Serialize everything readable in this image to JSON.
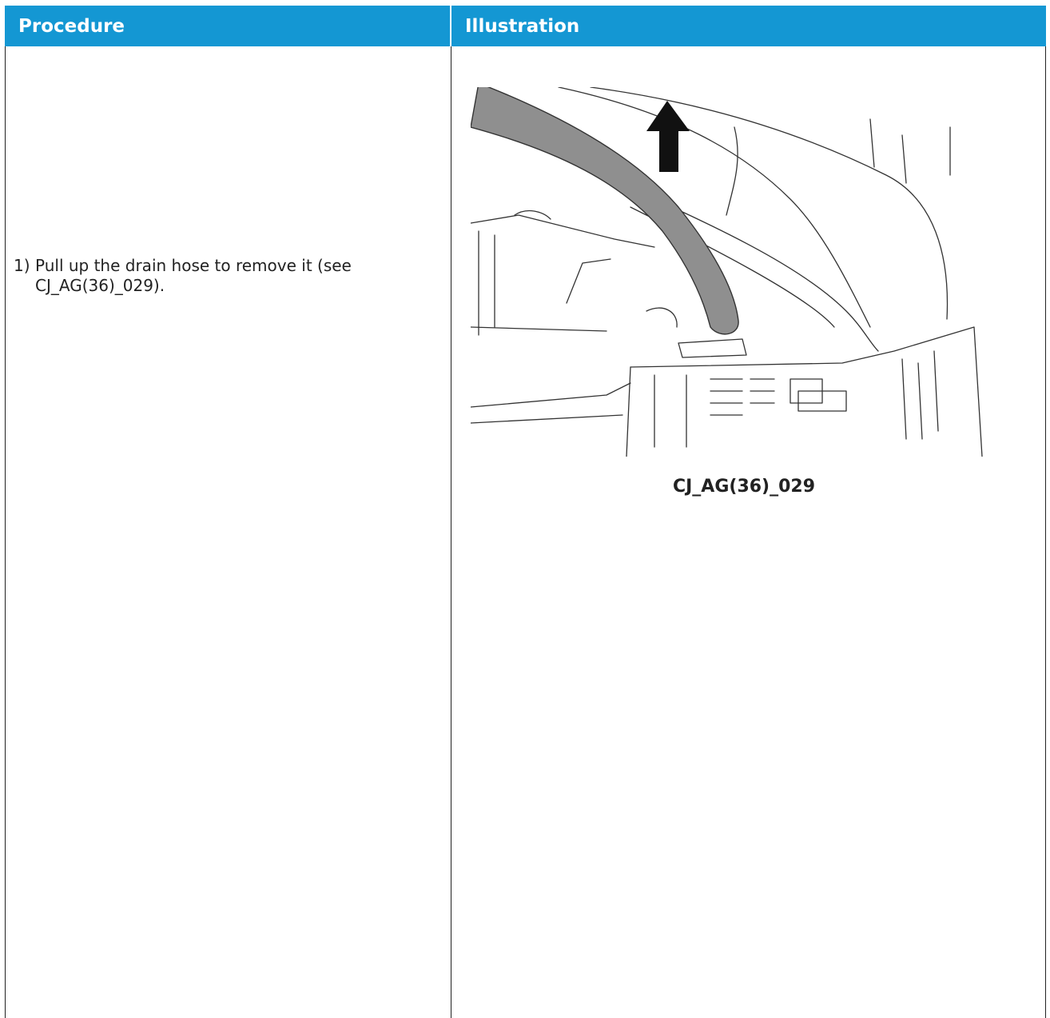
{
  "table": {
    "headers": {
      "procedure": "Procedure",
      "illustration": "Illustration"
    }
  },
  "steps": [
    {
      "number": "1)",
      "text": "Pull up the drain hose to remove it (see CJ_AG(36)_029)."
    }
  ],
  "figure": {
    "caption": "CJ_AG(36)_029",
    "icons": [
      "up-arrow-icon"
    ],
    "colors": {
      "hose": "#8f8f8f",
      "line": "#333333"
    }
  },
  "colors": {
    "header_bg": "#1497d3",
    "header_text": "#ffffff",
    "border": "#222222"
  }
}
